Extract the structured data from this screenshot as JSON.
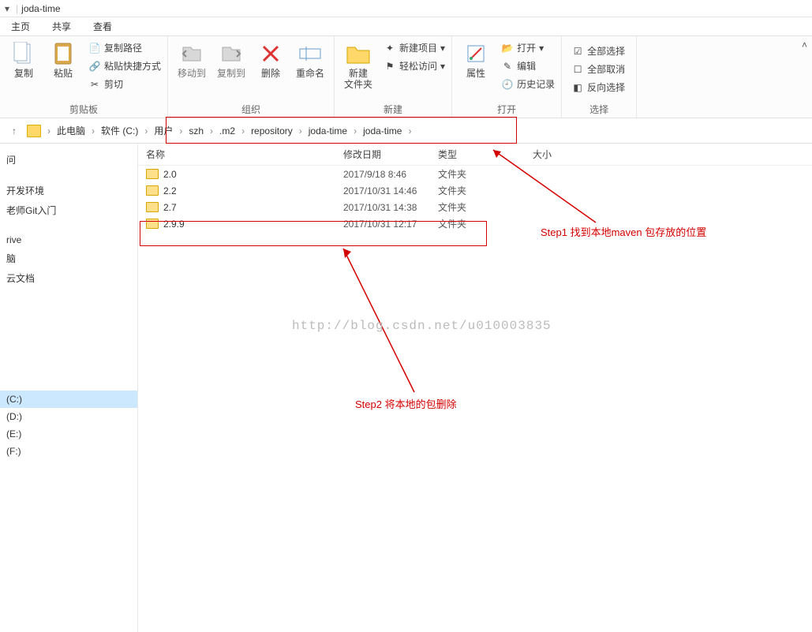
{
  "window": {
    "title": "joda-time"
  },
  "tabs": {
    "home": "主页",
    "share": "共享",
    "view": "查看"
  },
  "ribbon": {
    "clipboard": {
      "copy": "复制",
      "paste": "粘贴",
      "copy_path": "复制路径",
      "paste_shortcut": "粘贴快捷方式",
      "cut": "剪切",
      "label": "剪贴板"
    },
    "organize": {
      "move_to": "移动到",
      "copy_to": "复制到",
      "delete": "删除",
      "rename": "重命名",
      "label": "组织"
    },
    "new": {
      "new_folder": "新建\n文件夹",
      "new_item": "新建项目",
      "easy_access": "轻松访问",
      "label": "新建"
    },
    "open": {
      "properties": "属性",
      "open": "打开",
      "edit": "编辑",
      "history": "历史记录",
      "label": "打开"
    },
    "select": {
      "select_all": "全部选择",
      "select_none": "全部取消",
      "invert": "反向选择",
      "label": "选择"
    }
  },
  "breadcrumb": {
    "items": [
      "此电脑",
      "软件 (C:)",
      "用户",
      "szh",
      ".m2",
      "repository",
      "joda-time",
      "joda-time"
    ]
  },
  "columns": {
    "name": "名称",
    "date": "修改日期",
    "type": "类型",
    "size": "大小"
  },
  "files": [
    {
      "name": "2.0",
      "date": "2017/9/18 8:46",
      "type": "文件夹"
    },
    {
      "name": "2.2",
      "date": "2017/10/31 14:46",
      "type": "文件夹"
    },
    {
      "name": "2.7",
      "date": "2017/10/31 14:38",
      "type": "文件夹"
    },
    {
      "name": "2.9.9",
      "date": "2017/10/31 12:17",
      "type": "文件夹"
    }
  ],
  "sidebar": {
    "g1": [
      "问",
      "开发环境",
      "老师Git入门"
    ],
    "g2": [
      "rive",
      "脑",
      "云文档"
    ],
    "drives": [
      "(C:)",
      "(D:)",
      "(E:)",
      "(F:)"
    ]
  },
  "annotations": {
    "step1": "Step1 找到本地maven 包存放的位置",
    "step2": "Step2 将本地的包删除"
  },
  "watermark": "http://blog.csdn.net/u010003835"
}
